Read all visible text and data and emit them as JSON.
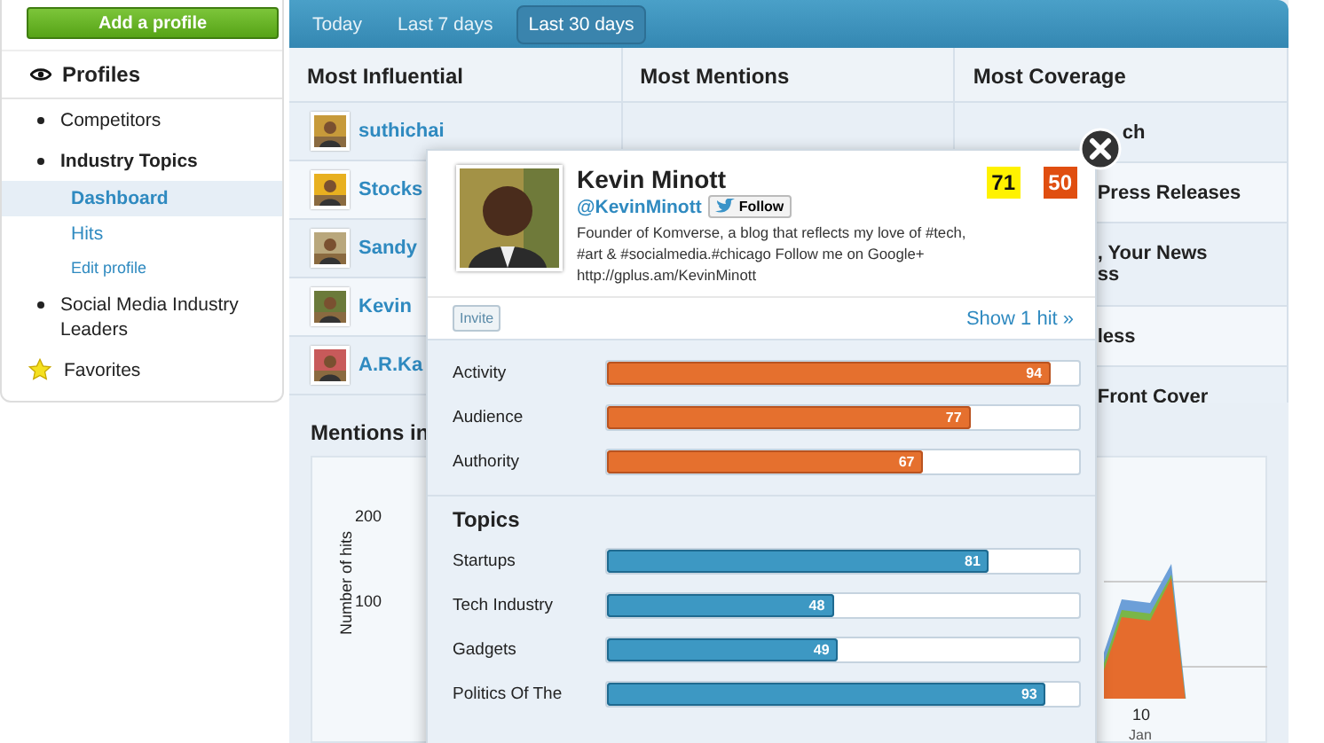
{
  "sidebar": {
    "add_button": "Add a profile",
    "title": "Profiles",
    "items": [
      {
        "kind": "group",
        "label": "Competitors",
        "expanded": false
      },
      {
        "kind": "group",
        "label": "Industry Topics",
        "expanded": true,
        "children": [
          {
            "kind": "page",
            "label": "Dashboard",
            "selected": true
          },
          {
            "kind": "page",
            "label": "Hits",
            "selected": false
          },
          {
            "kind": "action",
            "label": "Edit profile",
            "selected": false
          }
        ]
      },
      {
        "kind": "group",
        "label": "Social Media Industry Leaders",
        "expanded": false
      },
      {
        "kind": "favorite",
        "label": "Favorites",
        "expanded": false
      }
    ]
  },
  "tabs": [
    {
      "label": "Today",
      "selected": false
    },
    {
      "label": "Last 7 days",
      "selected": false
    },
    {
      "label": "Last 30 days",
      "selected": true
    }
  ],
  "columns": [
    {
      "title": "Most Influential",
      "rows": [
        "suthichai",
        "Stocks",
        "Sandy",
        "Kevin",
        "A.R.Ka"
      ]
    },
    {
      "title": "Most Mentions"
    },
    {
      "title": "Most Coverage",
      "rows": [
        "ch",
        "Press Releases",
        ", Your News\nss",
        "less",
        "Front Cover"
      ]
    }
  ],
  "chart_panel": {
    "title": "Mentions in",
    "ylabel": "Number of hits",
    "yticks": [
      "200",
      "100"
    ],
    "xtick": "10",
    "xtick_sub": "Jan"
  },
  "popup": {
    "name": "Kevin Minott",
    "handle": "@KevinMinott",
    "follow": "Follow",
    "bio": "Founder of Komverse, a blog that reflects my love of #tech, #art & #socialmedia.#chicago Follow me on Google+ http://gplus.am/KevinMinott",
    "score_a": "71",
    "score_b": "50",
    "invite": "Invite",
    "show_hits": "Show 1 hit »",
    "metrics": [
      {
        "label": "Activity",
        "level": 0.94,
        "value": "94"
      },
      {
        "label": "Audience",
        "level": 0.77,
        "value": "77"
      },
      {
        "label": "Authority",
        "level": 0.67,
        "value": "67"
      }
    ],
    "topics_title": "Topics",
    "topics": [
      {
        "label": "Startups",
        "level": 0.81,
        "value": "81"
      },
      {
        "label": "Tech Industry",
        "level": 0.48,
        "value": "48"
      },
      {
        "label": "Gadgets",
        "level": 0.49,
        "value": "49"
      },
      {
        "label": "Politics Of The",
        "level": 0.93,
        "value": "93"
      }
    ]
  }
}
